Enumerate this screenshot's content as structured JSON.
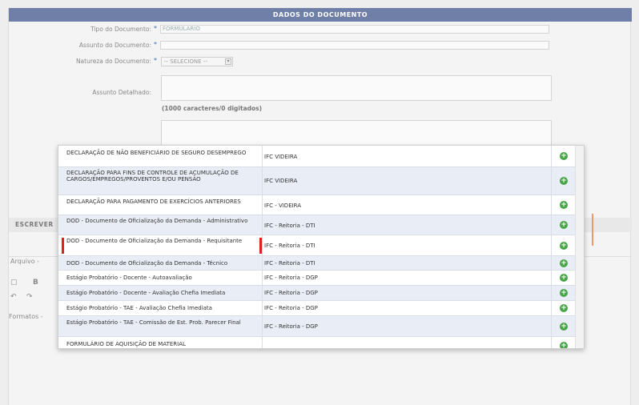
{
  "form": {
    "header": "DADOS DO DOCUMENTO",
    "tipo_label": "Tipo do Documento:",
    "tipo_value": "FORMULARIO",
    "assunto_label": "Assunto do Documento:",
    "assunto_value": "",
    "natureza_label": "Natureza do Documento:",
    "natureza_value": "-- SELECIONE --",
    "detalhado_label": "Assunto Detalhado:",
    "char_hint": "(1000 caracteres/0 digitados)",
    "required_mark": "*"
  },
  "editor": {
    "section_label": "ESCREVER",
    "menu_arquivo": "Arquivo -",
    "formats_label": "Formatos -",
    "tool_new": "▢",
    "tool_bold": "B",
    "tool_undo": "↶",
    "tool_redo": "↷"
  },
  "popup": {
    "add_glyph": "+",
    "rows": [
      {
        "name": "DECLARAÇÃO DE NÃO BENEFICIÁRIO DE SEGURO DESEMPREGO",
        "org": "IFC VIDEIRA"
      },
      {
        "name": "DECLARAÇÃO PARA FINS DE CONTROLE DE ACUMULAÇÃO DE CARGOS/EMPREGOS/PROVENTOS E/OU PENSÃO",
        "org": "IFC VIDEIRA"
      },
      {
        "name": "DECLARAÇÃO PARA PAGAMENTO DE EXERCÍCIOS ANTERIORES",
        "org": "IFC - VIDEIRA"
      },
      {
        "name": "DOD - Documento de Oficialização da Demanda - Administrativo",
        "org": "IFC - Reitoria - DTI"
      },
      {
        "name": "DOD - Documento de Oficialização da Demanda - Requisitante",
        "org": "IFC - Reitoria - DTI"
      },
      {
        "name": "DOD - Documento de Oficialização da Demanda - Técnico",
        "org": "IFC - Reitoria - DTI"
      },
      {
        "name": "Estágio Probatório - Docente - Autoavaliação",
        "org": "IFC - Reitoria - DGP"
      },
      {
        "name": "Estágio Probatório - Docente - Avaliação Chefia Imediata",
        "org": "IFC - Reitoria - DGP"
      },
      {
        "name": "Estágio Probatório - TAE - Avaliação Chefia Imediata",
        "org": "IFC - Reitoria - DGP"
      },
      {
        "name": "Estágio Probatório - TAE - Comissão de Est. Prob. Parecer Final",
        "org": "IFC - Reitoria - DGP"
      },
      {
        "name": "FORMULÁRIO DE AQUISIÇÃO DE MATERIAL",
        "org": ""
      }
    ]
  },
  "colors": {
    "header_bg": "#6f7fa8",
    "alt_row": "#e9eef6",
    "add_green": "#47a447",
    "highlight_red": "#e02020"
  }
}
